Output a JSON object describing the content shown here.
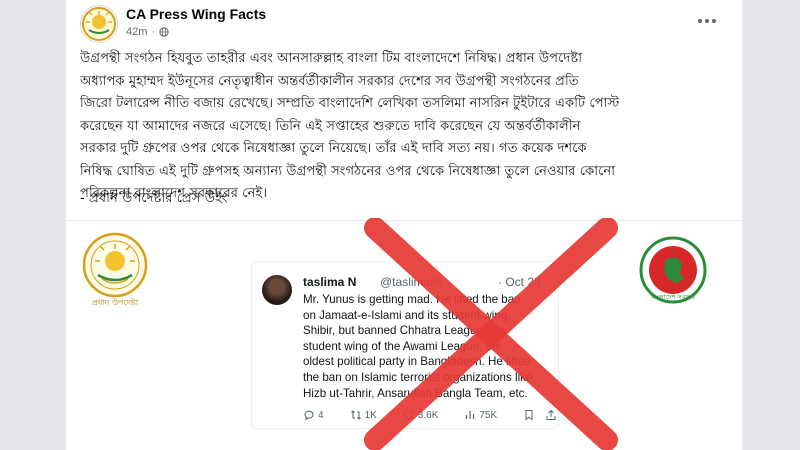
{
  "post": {
    "page_name": "CA Press Wing Facts",
    "time": "42m",
    "body": "উগ্রপন্থী সংগঠন হিযবুত তাহরীর এবং আনসারুল্লাহ বাংলা টিম বাংলাদেশে নিষিদ্ধ। প্রধান উপদেষ্টা\nঅধ্যাপক মুহাম্মদ ইউনূসের নেতৃত্বাধীন অন্তর্বর্তীকালীন সরকার দেশের সব উগ্রপন্থী সংগঠনের প্রতি\nজিরো টলারেন্স নীতি বজায় রেখেছে। সম্প্রতি বাংলাদেশি লেখিকা তসলিমা নাসরিন টুইটারে একটি পোস্ট\nকরেছেন যা আমাদের নজরে এসেছে। তিনি এই সপ্তাহের শুরুতে দাবি করেছেন যে অন্তর্বর্তীকালীন\nসরকার দুটি গ্রুপের ওপর থেকে নিষেধাজ্ঞা তুলে নিয়েছে। তাঁর এই দাবি সত্য নয়। গত কয়েক দশকে\nনিষিদ্ধ ঘোষিত এই দুটি গ্রুপসহ অন্যান্য উগ্রপন্থী সংগঠনের ওপর থেকে নিষেধাজ্ঞা তুলে নেওয়ার কোনো\nপরিকল্পনা বাংলাদেশ সরকারের নেই।",
    "signature": "- প্রধান উপদেষ্টার প্রেস উইং"
  },
  "media": {
    "left_seal_caption": "প্রধান উপদেষ্টা",
    "right_seal_caption": "বাংলাদেশ সরকার",
    "tweet": {
      "name": "taslima N",
      "handle": "@taslimans",
      "date": "· Oct 23",
      "text": "Mr. Yunus is getting mad. He lifted the ban\non Jamaat-e-Islami and its student wing,\nShibir, but banned Chhatra League, the\nstudent wing of the Awami League, the\noldest political party in Bangladesh. He lifted\nthe ban on Islamic terrorist organizations like\nHizb ut-Tahrir, Ansarullah Bangla Team, etc.",
      "replies": "4",
      "reposts": "1K",
      "likes": "3.6K",
      "views": "75K"
    }
  },
  "colors": {
    "cross_red": "#e53935",
    "seal_gold": "#d4a017",
    "seal_green": "#2e8b3a",
    "seal_red": "#d62828"
  }
}
